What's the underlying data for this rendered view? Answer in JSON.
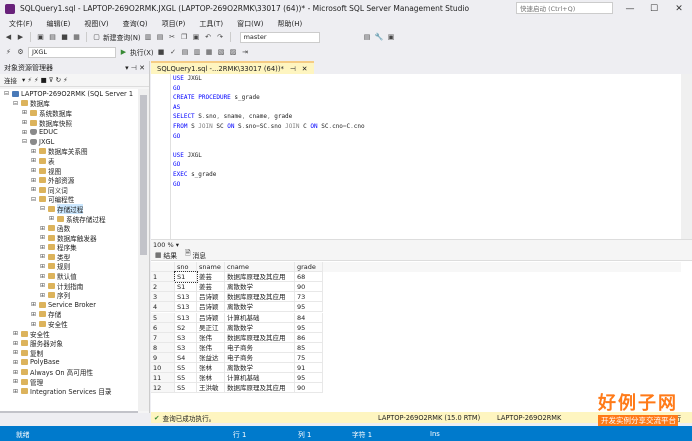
{
  "window": {
    "title": "SQLQuery1.sql - LAPTOP-269O2RMK.JXGL (LAPTOP-269O2RMK\\33017 (64))* - Microsoft SQL Server Management Studio",
    "quick_launch": "快速启动 (Ctrl+Q)",
    "controls": [
      "—",
      "☐",
      "✕"
    ]
  },
  "menu": [
    "文件(F)",
    "编辑(E)",
    "视图(V)",
    "查询(Q)",
    "项目(P)",
    "工具(T)",
    "窗口(W)",
    "帮助(H)"
  ],
  "toolbar1": {
    "new_query": "新建查询(N)",
    "db_combo": "master"
  },
  "toolbar2": {
    "db_combo": "JXGL",
    "execute": "执行(X)"
  },
  "object_explorer": {
    "title": "对象资源管理器",
    "connect": "连接",
    "tree": [
      {
        "label": "LAPTOP-269O2RMK (SQL Server 1",
        "level": 0,
        "exp": "⊟",
        "icon": "srv"
      },
      {
        "label": "数据库",
        "level": 1,
        "exp": "⊟",
        "icon": "fold"
      },
      {
        "label": "系统数据库",
        "level": 2,
        "exp": "⊞",
        "icon": "fold"
      },
      {
        "label": "数据库快照",
        "level": 2,
        "exp": "⊞",
        "icon": "fold"
      },
      {
        "label": "EDUC",
        "level": 2,
        "exp": "⊞",
        "icon": "db"
      },
      {
        "label": "JXGL",
        "level": 2,
        "exp": "⊟",
        "icon": "db"
      },
      {
        "label": "数据库关系图",
        "level": 3,
        "exp": "⊞",
        "icon": "fold"
      },
      {
        "label": "表",
        "level": 3,
        "exp": "⊞",
        "icon": "fold"
      },
      {
        "label": "视图",
        "level": 3,
        "exp": "⊞",
        "icon": "fold"
      },
      {
        "label": "外部资源",
        "level": 3,
        "exp": "⊞",
        "icon": "fold"
      },
      {
        "label": "同义词",
        "level": 3,
        "exp": "⊞",
        "icon": "fold"
      },
      {
        "label": "可编程性",
        "level": 3,
        "exp": "⊟",
        "icon": "fold"
      },
      {
        "label": "存储过程",
        "level": 4,
        "exp": "⊟",
        "icon": "fold"
      },
      {
        "label": "系统存储过程",
        "level": 5,
        "exp": "⊞",
        "icon": "fold"
      },
      {
        "label": "函数",
        "level": 4,
        "exp": "⊞",
        "icon": "fold"
      },
      {
        "label": "数据库触发器",
        "level": 4,
        "exp": "⊞",
        "icon": "fold"
      },
      {
        "label": "程序集",
        "level": 4,
        "exp": "⊞",
        "icon": "fold"
      },
      {
        "label": "类型",
        "level": 4,
        "exp": "⊞",
        "icon": "fold"
      },
      {
        "label": "规则",
        "level": 4,
        "exp": "⊞",
        "icon": "fold"
      },
      {
        "label": "默认值",
        "level": 4,
        "exp": "⊞",
        "icon": "fold"
      },
      {
        "label": "计划指南",
        "level": 4,
        "exp": "⊞",
        "icon": "fold"
      },
      {
        "label": "序列",
        "level": 4,
        "exp": "⊞",
        "icon": "fold"
      },
      {
        "label": "Service Broker",
        "level": 3,
        "exp": "⊞",
        "icon": "fold"
      },
      {
        "label": "存储",
        "level": 3,
        "exp": "⊞",
        "icon": "fold"
      },
      {
        "label": "安全性",
        "level": 3,
        "exp": "⊞",
        "icon": "fold"
      },
      {
        "label": "安全性",
        "level": 1,
        "exp": "⊞",
        "icon": "fold"
      },
      {
        "label": "服务器对象",
        "level": 1,
        "exp": "⊞",
        "icon": "fold"
      },
      {
        "label": "复制",
        "level": 1,
        "exp": "⊞",
        "icon": "fold"
      },
      {
        "label": "PolyBase",
        "level": 1,
        "exp": "⊞",
        "icon": "fold"
      },
      {
        "label": "Always On 高可用性",
        "level": 1,
        "exp": "⊞",
        "icon": "fold"
      },
      {
        "label": "管理",
        "level": 1,
        "exp": "⊞",
        "icon": "fold"
      },
      {
        "label": "Integration Services 目录",
        "level": 1,
        "exp": "⊞",
        "icon": "fold"
      }
    ]
  },
  "editor": {
    "tab_label": "SQLQuery1.sql -...2RMK\\33017 (64))*",
    "tab_pin": "⊣",
    "tab_close": "✕",
    "lines": [
      [
        {
          "t": "USE ",
          "c": "kw"
        },
        {
          "t": "JXGL",
          "c": "id"
        }
      ],
      [
        {
          "t": "GO",
          "c": "kw"
        }
      ],
      [
        {
          "t": "CREATE PROCEDURE ",
          "c": "kw"
        },
        {
          "t": "s_grade",
          "c": "id"
        }
      ],
      [
        {
          "t": "AS",
          "c": "kw"
        }
      ],
      [
        {
          "t": "SELECT ",
          "c": "kw"
        },
        {
          "t": "S",
          "c": "id"
        },
        {
          "t": ".",
          "c": "gr"
        },
        {
          "t": "sno",
          "c": "id"
        },
        {
          "t": ", ",
          "c": "gr"
        },
        {
          "t": "sname",
          "c": "id"
        },
        {
          "t": ", ",
          "c": "gr"
        },
        {
          "t": "cname",
          "c": "id"
        },
        {
          "t": ", ",
          "c": "gr"
        },
        {
          "t": "grade",
          "c": "id"
        }
      ],
      [
        {
          "t": "FROM ",
          "c": "kw"
        },
        {
          "t": "S ",
          "c": "id"
        },
        {
          "t": "JOIN ",
          "c": "gr"
        },
        {
          "t": "SC ",
          "c": "id"
        },
        {
          "t": "ON ",
          "c": "kw"
        },
        {
          "t": "S",
          "c": "id"
        },
        {
          "t": ".",
          "c": "gr"
        },
        {
          "t": "sno",
          "c": "id"
        },
        {
          "t": "=",
          "c": "gr"
        },
        {
          "t": "SC",
          "c": "id"
        },
        {
          "t": ".",
          "c": "gr"
        },
        {
          "t": "sno ",
          "c": "id"
        },
        {
          "t": "JOIN ",
          "c": "gr"
        },
        {
          "t": "C ",
          "c": "id"
        },
        {
          "t": "ON ",
          "c": "kw"
        },
        {
          "t": "SC",
          "c": "id"
        },
        {
          "t": ".",
          "c": "gr"
        },
        {
          "t": "cno",
          "c": "id"
        },
        {
          "t": "=",
          "c": "gr"
        },
        {
          "t": "C",
          "c": "id"
        },
        {
          "t": ".",
          "c": "gr"
        },
        {
          "t": "cno",
          "c": "id"
        }
      ],
      [
        {
          "t": "GO",
          "c": "kw"
        }
      ],
      [],
      [
        {
          "t": "USE ",
          "c": "kw"
        },
        {
          "t": "JXGL",
          "c": "id"
        }
      ],
      [
        {
          "t": "GO",
          "c": "kw"
        }
      ],
      [
        {
          "t": "EXEC ",
          "c": "kw"
        },
        {
          "t": "s_grade",
          "c": "id"
        }
      ],
      [
        {
          "t": "GO",
          "c": "kw"
        }
      ]
    ],
    "zoom": "100 %"
  },
  "results": {
    "tab_results": "结果",
    "tab_messages": "消息",
    "columns": [
      "sno",
      "sname",
      "cname",
      "grade"
    ],
    "rows": [
      [
        "1",
        "S1",
        "姜芸",
        "数据库原理及其应用",
        "68"
      ],
      [
        "2",
        "S1",
        "姜芸",
        "离散数学",
        "90"
      ],
      [
        "3",
        "S13",
        "吕诗颖",
        "数据库原理及其应用",
        "73"
      ],
      [
        "4",
        "S13",
        "吕诗颖",
        "离散数学",
        "95"
      ],
      [
        "5",
        "S13",
        "吕诗颖",
        "计算机基础",
        "84"
      ],
      [
        "6",
        "S2",
        "吴正江",
        "离散数学",
        "95"
      ],
      [
        "7",
        "S3",
        "张伟",
        "数据库原理及其应用",
        "86"
      ],
      [
        "8",
        "S3",
        "张伟",
        "电子商务",
        "85"
      ],
      [
        "9",
        "S4",
        "张益达",
        "电子商务",
        "75"
      ],
      [
        "10",
        "S5",
        "张林",
        "离散数学",
        "91"
      ],
      [
        "11",
        "S5",
        "张林",
        "计算机基础",
        "95"
      ],
      [
        "12",
        "S5",
        "王洪敏",
        "数据库原理及其应用",
        "90"
      ]
    ]
  },
  "query_status": {
    "message": "查询已成功执行。",
    "server": "LAPTOP-269O2RMK (15.0 RTM)",
    "server2": "LAPTOP-269O2RMK",
    "rows": "12 行"
  },
  "statusbar": {
    "ready": "就绪",
    "row": "行 1",
    "col": "列 1",
    "char": "字符 1",
    "ins": "Ins"
  },
  "watermark": {
    "site": "www.haolizi.com",
    "logo": "好例子网",
    "slogan": "开发实例分享交流平台"
  }
}
